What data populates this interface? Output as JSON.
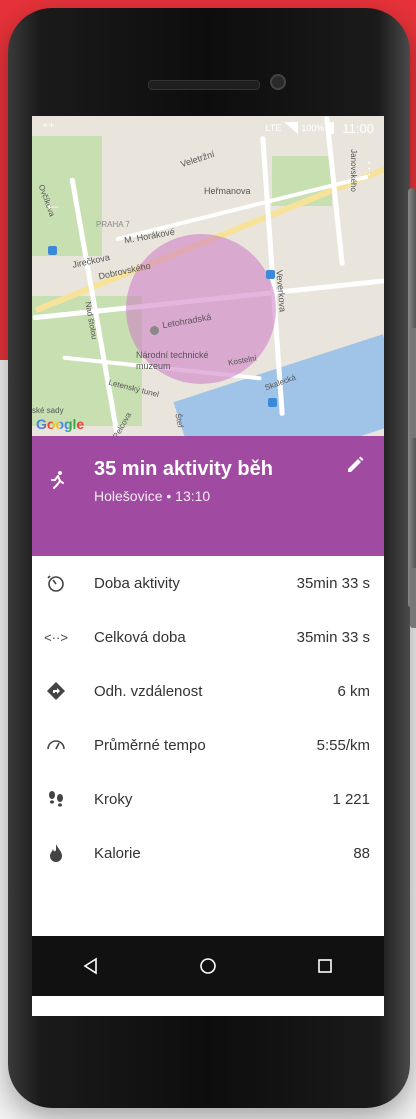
{
  "status_bar": {
    "left_glyph": "⁺⁺",
    "network": "LTE",
    "battery_percent": "100%",
    "time": "11:00"
  },
  "map": {
    "labels": [
      "Veletržní",
      "Heřmanova",
      "Janovského",
      "Ovčíkova",
      "PRAHA 7",
      "M. Horákové",
      "Jirečkova",
      "Dobrovského",
      "Veverkova",
      "Nad štolou",
      "Letohradská",
      "Národní technické muzeum",
      "Kostelní",
      "Skalecká",
      "Letenský tunel",
      "ské sady",
      "Štef",
      "Pelcova"
    ],
    "google_logo": "Google"
  },
  "activity": {
    "title": "35 min aktivity běh",
    "subtitle": "Holešovice • 13:10",
    "accent_color": "#a04aa2"
  },
  "stats": [
    {
      "icon": "timer-icon",
      "label": "Doba aktivity",
      "value": "35min 33 s"
    },
    {
      "icon": "code-arrows-icon",
      "label": "Celková doba",
      "value": "35min 33 s"
    },
    {
      "icon": "navigation-diamond-icon",
      "label": "Odh. vzdálenost",
      "value": "6 km"
    },
    {
      "icon": "speed-gauge-icon",
      "label": "Průměrné tempo",
      "value": "5:55/km"
    },
    {
      "icon": "footsteps-icon",
      "label": "Kroky",
      "value": "1 221"
    },
    {
      "icon": "flame-icon",
      "label": "Kalorie",
      "value": "88"
    }
  ],
  "nav": {
    "back": "◁",
    "home": "○",
    "recents": "□"
  }
}
